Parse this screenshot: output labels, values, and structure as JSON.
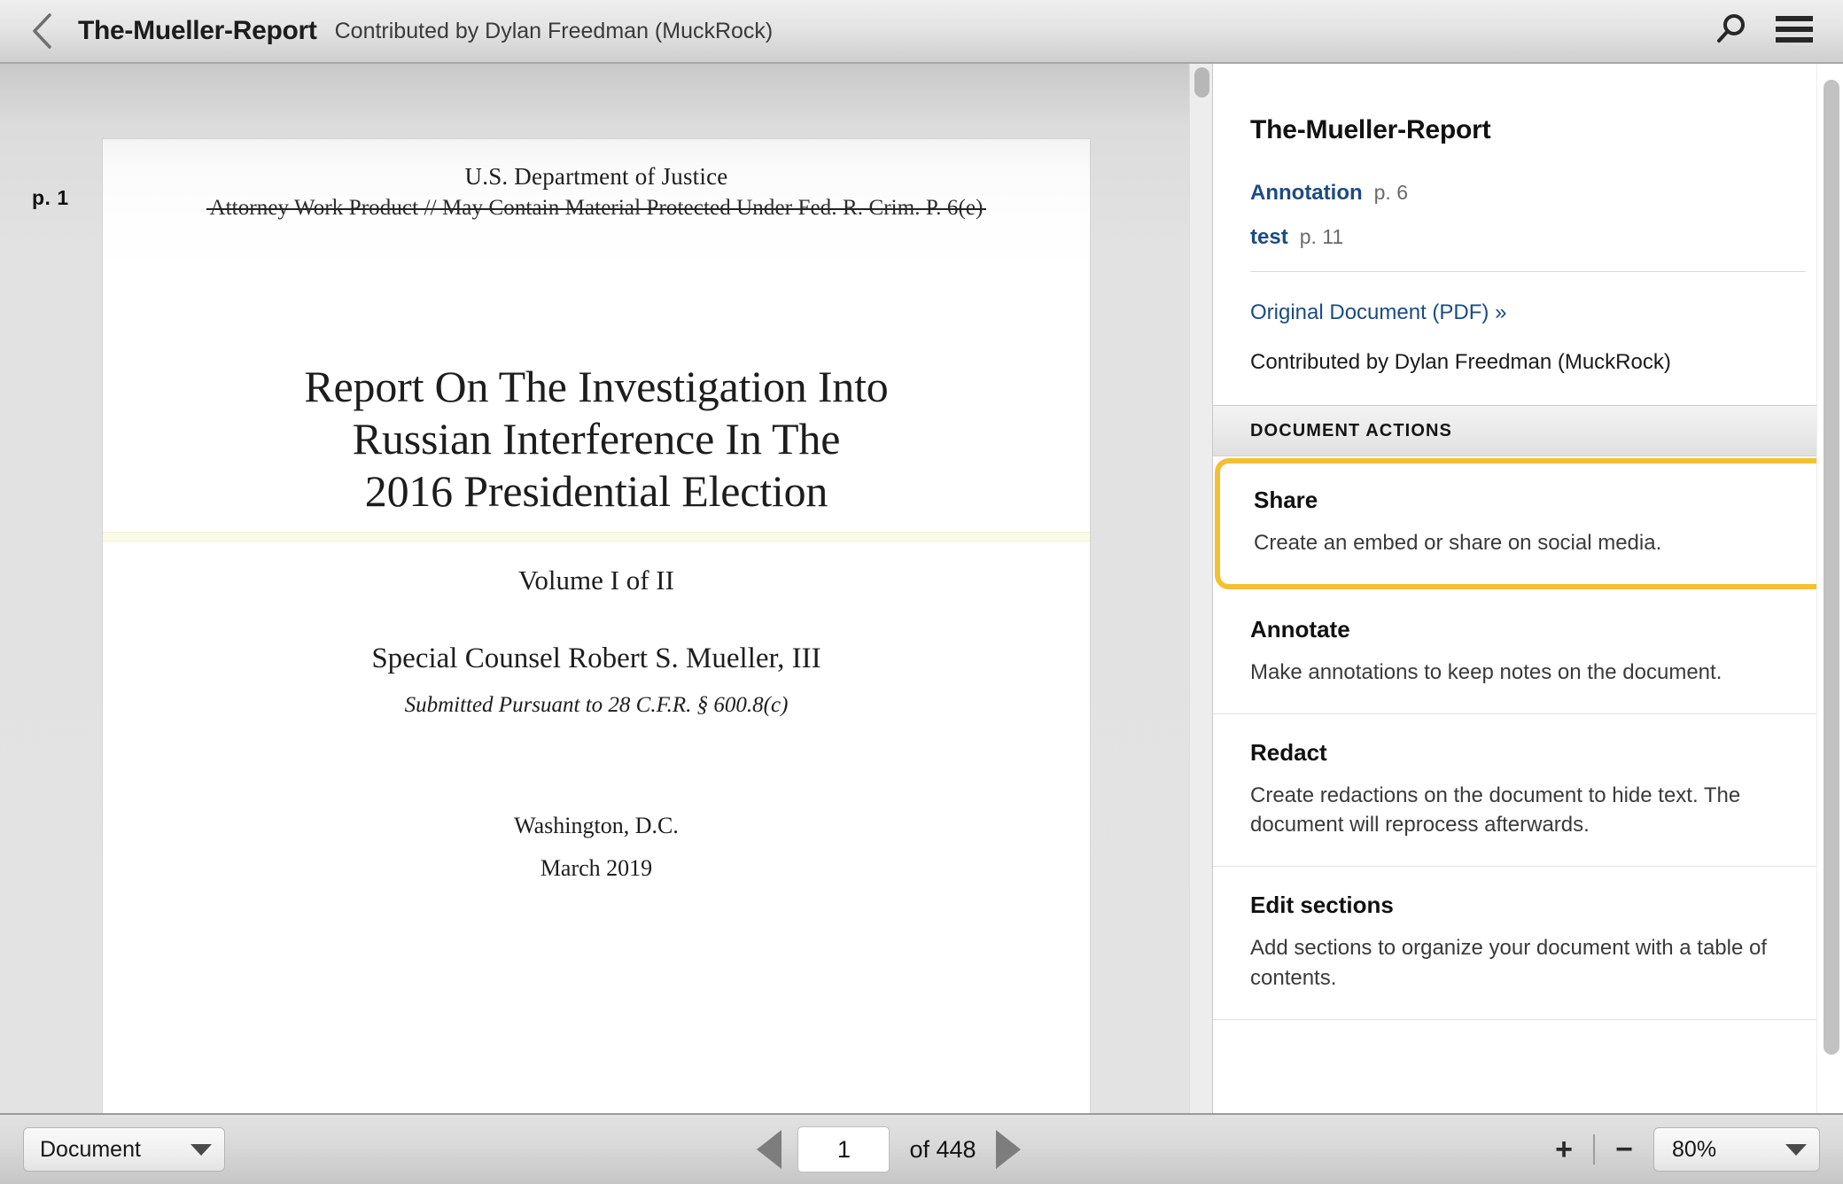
{
  "header": {
    "back_icon": "chevron-left-icon",
    "title": "The-Mueller-Report",
    "contributor": "Contributed by Dylan Freedman (MuckRock)",
    "search_icon": "search-icon",
    "menu_icon": "hamburger-menu-icon"
  },
  "viewer": {
    "page_label": "p. 1",
    "page": {
      "department": "U.S. Department of Justice",
      "stamp": "Attorney Work Product // May Contain Material Protected Under Fed. R. Crim. P. 6(e)",
      "title_line1": "Report On The Investigation Into",
      "title_line2": "Russian Interference In The",
      "title_line3": "2016 Presidential Election",
      "volume": "Volume I of II",
      "counsel": "Special Counsel Robert S. Mueller, III",
      "submitted": "Submitted Pursuant to 28 C.F.R. § 600.8(c)",
      "city": "Washington, D.C.",
      "date": "March 2019"
    }
  },
  "sidebar": {
    "title": "The-Mueller-Report",
    "notes": [
      {
        "name": "Annotation",
        "page": "p. 6"
      },
      {
        "name": "test",
        "page": "p. 11"
      }
    ],
    "original_link": "Original Document (PDF) »",
    "contributor": "Contributed by Dylan Freedman (MuckRock)",
    "section_heading": "DOCUMENT ACTIONS",
    "actions": [
      {
        "title": "Share",
        "desc": "Create an embed or share on social media.",
        "highlighted": true
      },
      {
        "title": "Annotate",
        "desc": "Make annotations to keep notes on the document.",
        "highlighted": false
      },
      {
        "title": "Redact",
        "desc": "Create redactions on the document to hide text. The document will reprocess afterwards.",
        "highlighted": false
      },
      {
        "title": "Edit sections",
        "desc": "Add sections to organize your document with a table of contents.",
        "highlighted": false
      }
    ]
  },
  "bottombar": {
    "mode_select": "Document",
    "prev_icon": "triangle-left-icon",
    "next_icon": "triangle-right-icon",
    "page_value": "1",
    "page_total": "of 448",
    "zoom_in": "+",
    "zoom_out": "−",
    "zoom_level": "80%"
  },
  "colors": {
    "highlight": "#f4c033",
    "link": "#1c4b82",
    "annotation_band": "#fbfbe6"
  }
}
